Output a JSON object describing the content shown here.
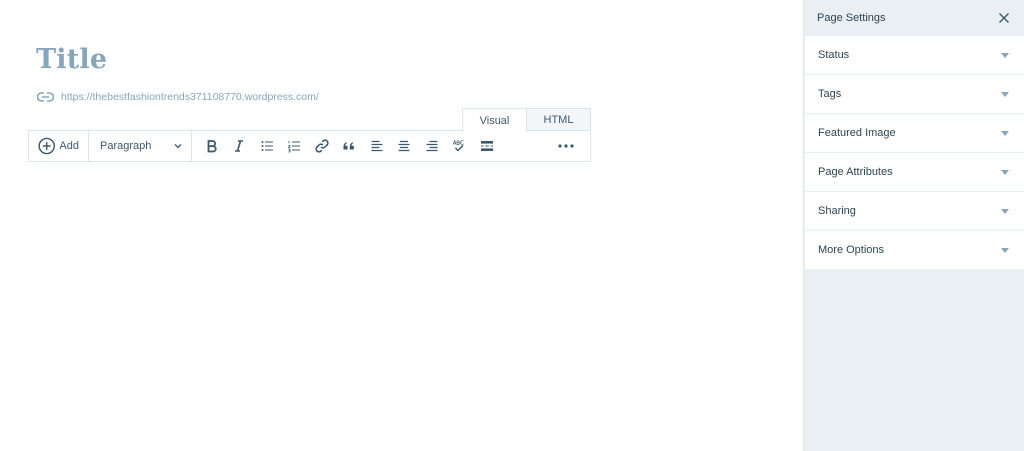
{
  "editor": {
    "title_placeholder": "Title",
    "permalink": "https://thebestfashiontrends371108770.wordpress.com/",
    "tabs": [
      {
        "label": "Visual",
        "active": true
      },
      {
        "label": "HTML",
        "active": false
      }
    ],
    "toolbar": {
      "add_label": "Add",
      "format_value": "Paragraph",
      "buttons": [
        {
          "icon": "bold-icon"
        },
        {
          "icon": "italic-icon"
        },
        {
          "icon": "bulleted-list-icon"
        },
        {
          "icon": "numbered-list-icon"
        },
        {
          "icon": "link-icon"
        },
        {
          "icon": "blockquote-icon"
        },
        {
          "icon": "align-left-icon"
        },
        {
          "icon": "align-center-icon"
        },
        {
          "icon": "align-right-icon"
        },
        {
          "icon": "spellcheck-icon"
        },
        {
          "icon": "read-more-icon"
        }
      ],
      "more_icon": "ellipsis-icon"
    }
  },
  "sidebar": {
    "title": "Page Settings",
    "close_icon": "close-icon",
    "sections": [
      {
        "label": "Status"
      },
      {
        "label": "Tags"
      },
      {
        "label": "Featured Image"
      },
      {
        "label": "Page Attributes"
      },
      {
        "label": "Sharing"
      },
      {
        "label": "More Options"
      }
    ]
  },
  "colors": {
    "accent": "#87a6bc",
    "text": "#2e4453",
    "icon": "#3d596d",
    "sidebar_bg": "#e9eff3",
    "border": "#dce5ec"
  }
}
